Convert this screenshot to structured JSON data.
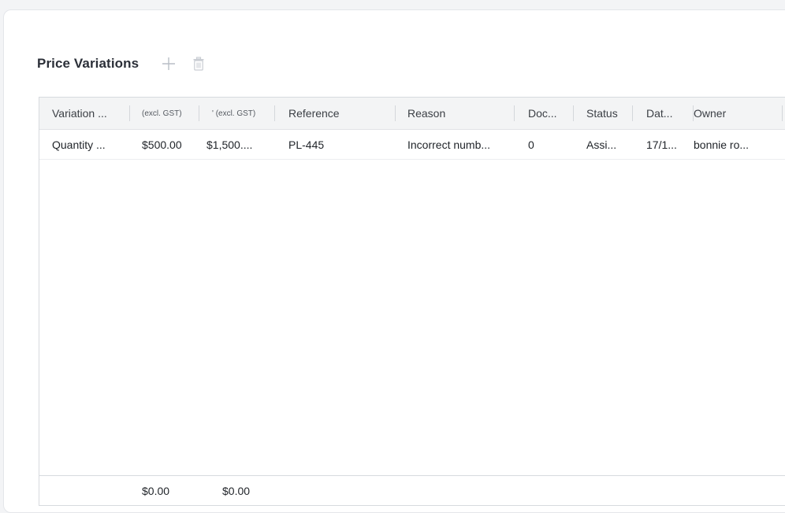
{
  "section": {
    "title": "Price Variations"
  },
  "icons": {
    "add": "plus-icon",
    "delete": "trash-icon"
  },
  "colors": {
    "icon_muted": "#b9bec6",
    "header_bg": "#f3f4f5",
    "border": "#d7dade"
  },
  "table": {
    "columns": [
      {
        "label": "Variation ..."
      },
      {
        "label": "(excl. GST)"
      },
      {
        "label": "' (excl. GST)"
      },
      {
        "label": "Reference"
      },
      {
        "label": "Reason"
      },
      {
        "label": "Doc..."
      },
      {
        "label": "Status"
      },
      {
        "label": "Dat..."
      },
      {
        "label": "Owner"
      }
    ],
    "rows": [
      {
        "variation": "Quantity ...",
        "amount_excl_gst": "$500.00",
        "total_excl_gst": "$1,500....",
        "reference": "PL-445",
        "reason": "Incorrect numb...",
        "docs": "0",
        "status": "Assi...",
        "date": "17/1...",
        "owner": "bonnie ro..."
      }
    ],
    "footer": {
      "amount_total": "$0.00",
      "total_total": "$0.00"
    }
  }
}
